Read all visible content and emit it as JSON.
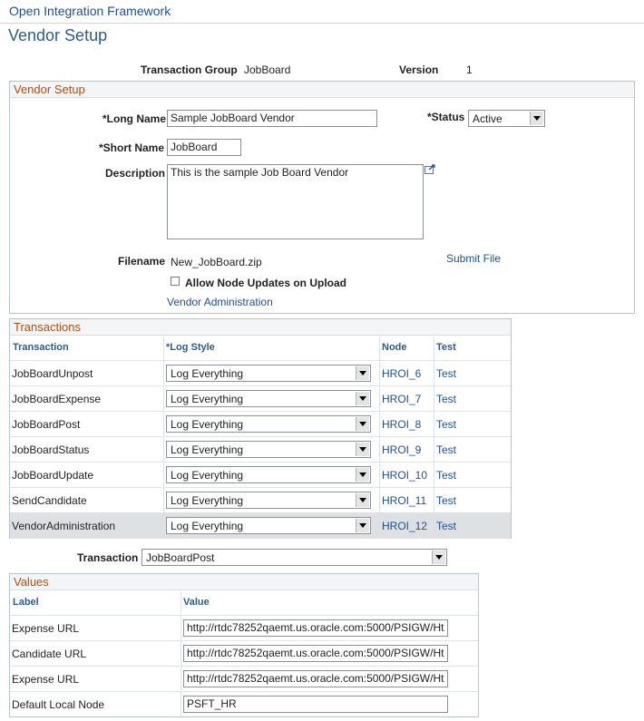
{
  "breadcrumb": "Open Integration Framework",
  "page_title": "Vendor Setup",
  "header": {
    "transaction_group_label": "Transaction Group",
    "transaction_group_value": "JobBoard",
    "version_label": "Version",
    "version_value": "1"
  },
  "vendor_setup": {
    "section_title": "Vendor Setup",
    "long_name_label": "*Long Name",
    "long_name_value": "Sample JobBoard Vendor",
    "status_label": "*Status",
    "status_value": "Active",
    "short_name_label": "*Short Name",
    "short_name_value": "JobBoard",
    "description_label": "Description",
    "description_value": "This is the sample Job Board Vendor",
    "filename_label": "Filename",
    "filename_value": "New_JobBoard.zip",
    "submit_file_link": "Submit File",
    "allow_node_updates_label": "Allow Node Updates on Upload",
    "allow_node_updates_checked": false,
    "vendor_admin_link": "Vendor Administration"
  },
  "transactions": {
    "section_title": "Transactions",
    "columns": [
      "Transaction",
      "*Log Style",
      "Node",
      "Test"
    ],
    "rows": [
      {
        "transaction": "JobBoardUnpost",
        "log_style": "Log Everything",
        "node": "HROI_6",
        "test": "Test"
      },
      {
        "transaction": "JobBoardExpense",
        "log_style": "Log Everything",
        "node": "HROI_7",
        "test": "Test"
      },
      {
        "transaction": "JobBoardPost",
        "log_style": "Log Everything",
        "node": "HROI_8",
        "test": "Test"
      },
      {
        "transaction": "JobBoardStatus",
        "log_style": "Log Everything",
        "node": "HROI_9",
        "test": "Test"
      },
      {
        "transaction": "JobBoardUpdate",
        "log_style": "Log Everything",
        "node": "HROI_10",
        "test": "Test"
      },
      {
        "transaction": "SendCandidate",
        "log_style": "Log Everything",
        "node": "HROI_11",
        "test": "Test"
      },
      {
        "transaction": "VendorAdministration",
        "log_style": "Log Everything",
        "node": "HROI_12",
        "test": "Test"
      }
    ]
  },
  "transaction_select": {
    "label": "Transaction",
    "value": "JobBoardPost"
  },
  "values": {
    "section_title": "Values",
    "columns": [
      "Label",
      "Value"
    ],
    "rows": [
      {
        "label": "Expense URL",
        "value": "http://rtdc78252qaemt.us.oracle.com:5000/PSIGW/Ht"
      },
      {
        "label": "Candidate URL",
        "value": "http://rtdc78252qaemt.us.oracle.com:5000/PSIGW/Ht"
      },
      {
        "label": "Expense URL",
        "value": "http://rtdc78252qaemt.us.oracle.com:5000/PSIGW/Ht"
      },
      {
        "label": "Default Local Node",
        "value": "PSFT_HR"
      }
    ]
  },
  "colors": {
    "section_title": "#b34d12",
    "link": "#1f4e97",
    "page_title": "#2d5b8a",
    "highlight_row": "#dde1e3"
  },
  "icons": {
    "expand_textarea": "expand-icon"
  }
}
